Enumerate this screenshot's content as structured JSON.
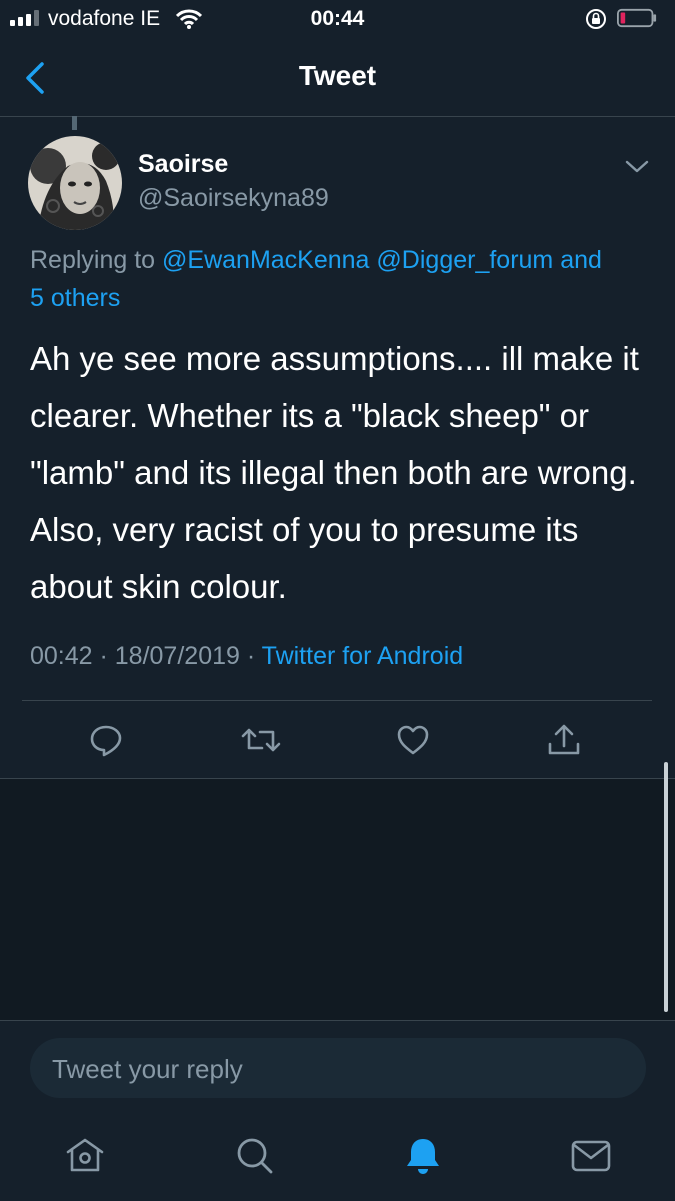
{
  "status_bar": {
    "carrier": "vodafone IE",
    "time": "00:44"
  },
  "nav": {
    "title": "Tweet"
  },
  "tweet": {
    "author_name": "Saoirse",
    "author_handle": "@Saoirsekyna89",
    "replying_prefix": "Replying to",
    "replying_to": [
      "@EwanMacKenna",
      "@Digger_forum"
    ],
    "replying_and": "and",
    "replying_others": "5 others",
    "text": "Ah ye see more assumptions.... ill make it clearer. Whether its a \"black sheep\" or \"lamb\" and its illegal then both are wrong. Also, very racist of you to presume its about skin colour.",
    "timestamp": "00:42 · 18/07/2019 ·",
    "source": "Twitter for Android"
  },
  "actions": {
    "reply": "reply-icon",
    "retweet": "retweet-icon",
    "like": "heart-icon",
    "share": "share-icon"
  },
  "reply_bar": {
    "placeholder": "Tweet your reply"
  },
  "tab_bar": {
    "active": "notifications",
    "items": [
      "home",
      "search",
      "notifications",
      "messages"
    ]
  },
  "colors": {
    "background": "#15202b",
    "accent": "#1da1f2",
    "muted": "#8899a6",
    "battery_low": "#e0245e"
  }
}
